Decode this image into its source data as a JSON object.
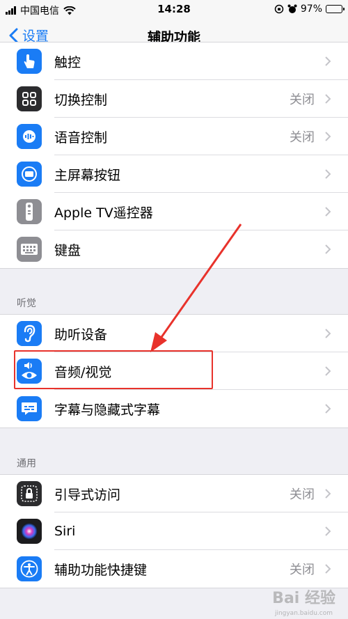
{
  "status_bar": {
    "carrier": "中国电信",
    "time": "14:28",
    "battery": "97%",
    "battery_level": 0.97
  },
  "nav": {
    "back_label": "设置",
    "title": "辅助功能"
  },
  "physical_group": {
    "items": [
      {
        "label": "触控",
        "value": "",
        "icon": "touch-hand-icon",
        "color": "#1a7cf5"
      },
      {
        "label": "切换控制",
        "value": "关闭",
        "icon": "switch-control-grid-icon",
        "color": "#2c2c2e"
      },
      {
        "label": "语音控制",
        "value": "关闭",
        "icon": "voice-control-icon",
        "color": "#1a7cf5"
      },
      {
        "label": "主屏幕按钮",
        "value": "",
        "icon": "home-button-icon",
        "color": "#1a7cf5"
      },
      {
        "label": "Apple TV遥控器",
        "value": "",
        "icon": "remote-icon",
        "color": "#8e8e93"
      },
      {
        "label": "键盘",
        "value": "",
        "icon": "keyboard-icon",
        "color": "#8e8e93"
      }
    ]
  },
  "hearing_group": {
    "header": "听觉",
    "items": [
      {
        "label": "助听设备",
        "value": "",
        "icon": "ear-icon",
        "color": "#1a7cf5"
      },
      {
        "label": "音频/视觉",
        "value": "",
        "icon": "audio-visual-icon",
        "color": "#1a7cf5"
      },
      {
        "label": "字幕与隐藏式字幕",
        "value": "",
        "icon": "subtitles-icon",
        "color": "#1a7cf5"
      }
    ]
  },
  "general_group": {
    "header": "通用",
    "items": [
      {
        "label": "引导式访问",
        "value": "关闭",
        "icon": "guided-access-lock-icon",
        "color": "#2c2c2e"
      },
      {
        "label": "Siri",
        "value": "",
        "icon": "siri-icon",
        "color": "#1c1c1e"
      },
      {
        "label": "辅助功能快捷键",
        "value": "关闭",
        "icon": "accessibility-shortcut-icon",
        "color": "#1a7cf5"
      }
    ]
  },
  "watermark": {
    "text": "Bai 经验",
    "sub": "jingyan.baidu.com"
  }
}
